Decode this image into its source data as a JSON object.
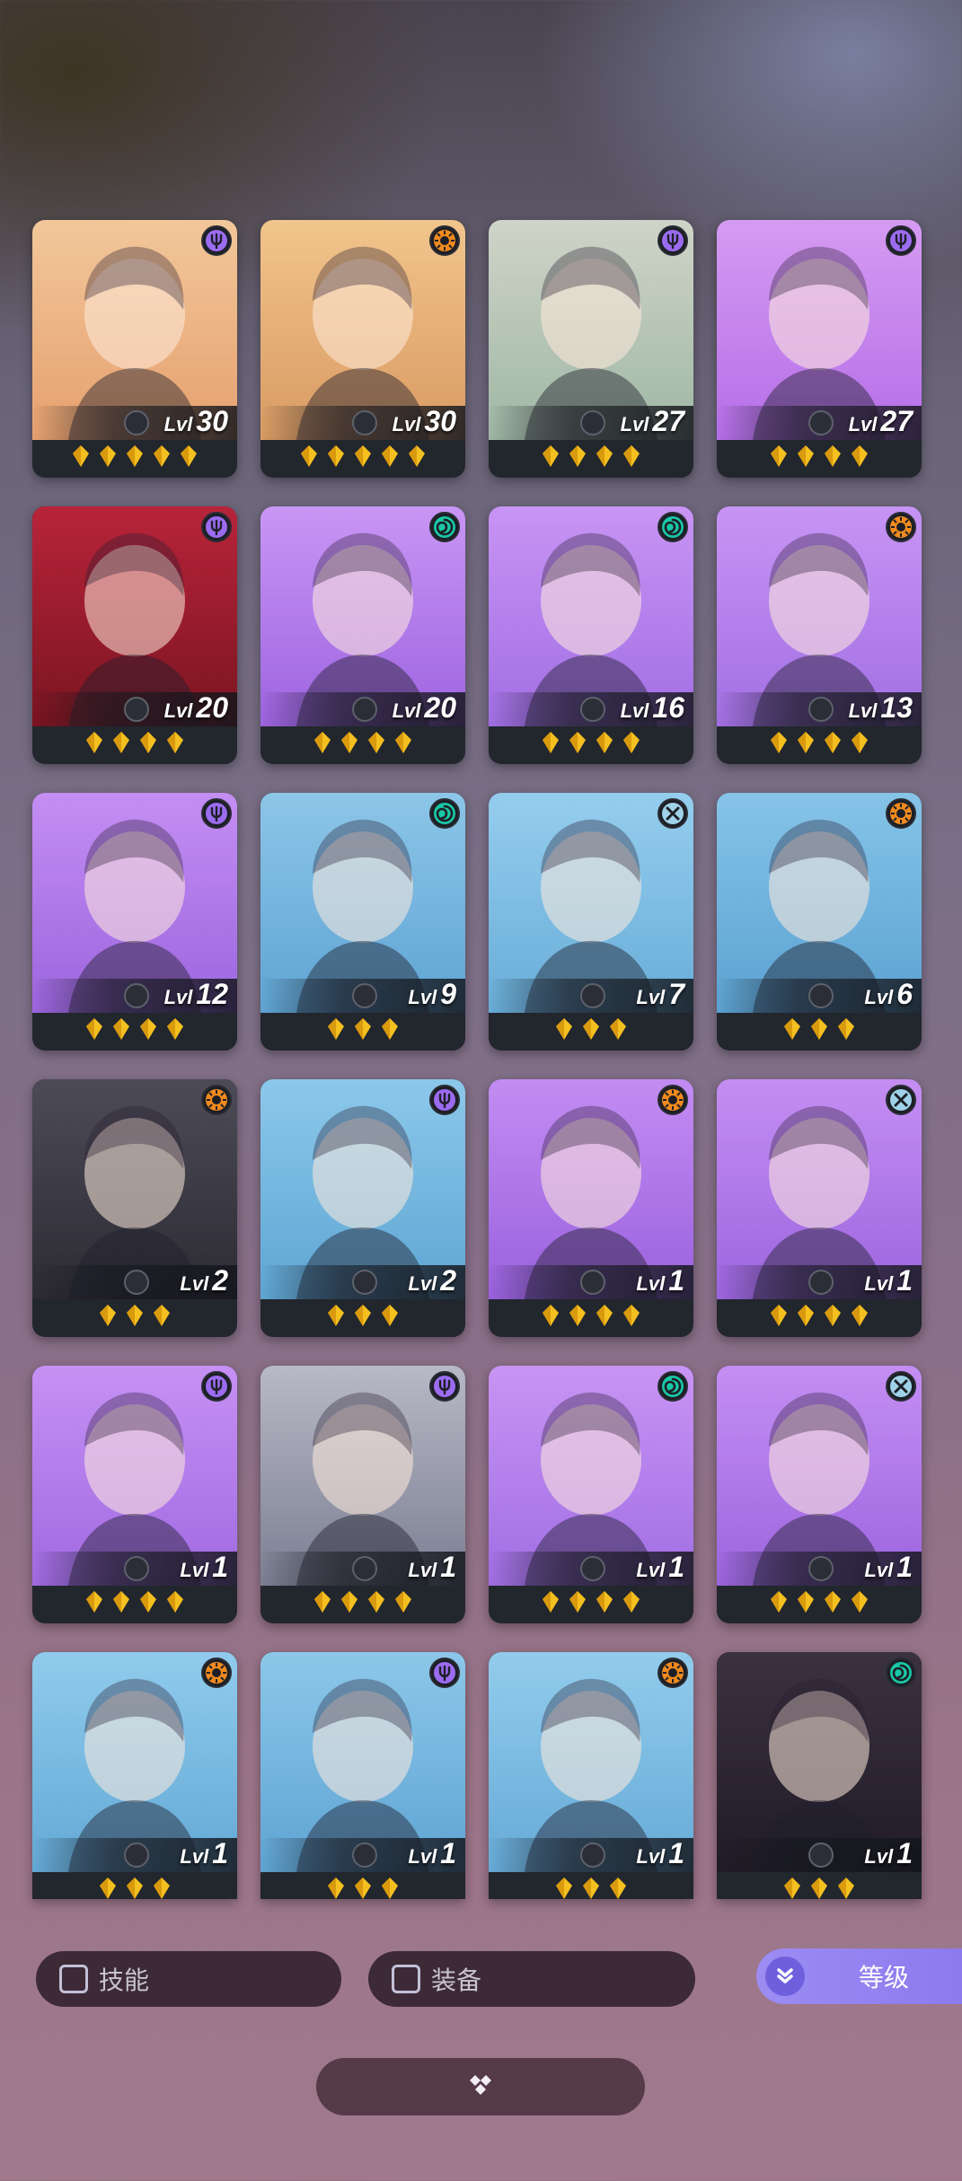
{
  "heroes": [
    {
      "level": "30",
      "stars": 5,
      "faction": "psi",
      "bg": [
        "#f2c79a",
        "#e6a06e"
      ]
    },
    {
      "level": "30",
      "stars": 5,
      "faction": "sun",
      "bg": [
        "#f1c58c",
        "#d99a63"
      ]
    },
    {
      "level": "27",
      "stars": 4,
      "faction": "psi",
      "bg": [
        "#cfd4c8",
        "#9fb7a4"
      ]
    },
    {
      "level": "27",
      "stars": 4,
      "faction": "psi",
      "bg": [
        "#d59bf2",
        "#b56ee8"
      ]
    },
    {
      "level": "20",
      "stars": 4,
      "faction": "psi",
      "bg": [
        "#b8243a",
        "#7a1420"
      ]
    },
    {
      "level": "20",
      "stars": 4,
      "faction": "swirl",
      "bg": [
        "#c996f5",
        "#9d63e0"
      ]
    },
    {
      "level": "16",
      "stars": 4,
      "faction": "swirl",
      "bg": [
        "#c894f4",
        "#a16ee4"
      ]
    },
    {
      "level": "13",
      "stars": 4,
      "faction": "sun",
      "bg": [
        "#c794f5",
        "#a26fe3"
      ]
    },
    {
      "level": "12",
      "stars": 4,
      "faction": "psi",
      "bg": [
        "#c48ef3",
        "#9c65df"
      ]
    },
    {
      "level": "9",
      "stars": 3,
      "faction": "swirl",
      "bg": [
        "#8cc6e8",
        "#5fa4d4"
      ]
    },
    {
      "level": "7",
      "stars": 3,
      "faction": "cross",
      "bg": [
        "#95cdee",
        "#68add8"
      ]
    },
    {
      "level": "6",
      "stars": 3,
      "faction": "sun",
      "bg": [
        "#86c4e8",
        "#5ba2d2"
      ]
    },
    {
      "level": "2",
      "stars": 3,
      "faction": "sun",
      "bg": [
        "#4d4b57",
        "#2c2b33"
      ]
    },
    {
      "level": "2",
      "stars": 3,
      "faction": "psi",
      "bg": [
        "#8cc8ea",
        "#5ea6d4"
      ]
    },
    {
      "level": "1",
      "stars": 4,
      "faction": "sun",
      "bg": [
        "#c38cf2",
        "#9961de"
      ]
    },
    {
      "level": "1",
      "stars": 4,
      "faction": "cross",
      "bg": [
        "#c48ef3",
        "#9c65df"
      ]
    },
    {
      "level": "1",
      "stars": 4,
      "faction": "psi",
      "bg": [
        "#c690f4",
        "#a06ae2"
      ]
    },
    {
      "level": "1",
      "stars": 4,
      "faction": "psi",
      "bg": [
        "#b8b9c6",
        "#7b7f92"
      ]
    },
    {
      "level": "1",
      "stars": 4,
      "faction": "swirl",
      "bg": [
        "#c894f4",
        "#a16ee4"
      ]
    },
    {
      "level": "1",
      "stars": 4,
      "faction": "cross",
      "bg": [
        "#c48ef3",
        "#9c65df"
      ]
    },
    {
      "level": "1",
      "stars": 3,
      "faction": "sun",
      "bg": [
        "#90cbec",
        "#63a9d6"
      ]
    },
    {
      "level": "1",
      "stars": 3,
      "faction": "psi",
      "bg": [
        "#8cc7e9",
        "#5fa4d4"
      ]
    },
    {
      "level": "1",
      "stars": 3,
      "faction": "sun",
      "bg": [
        "#92ccec",
        "#66aad7"
      ]
    },
    {
      "level": "1",
      "stars": 3,
      "faction": "swirl",
      "bg": [
        "#3b3240",
        "#201b26"
      ]
    }
  ],
  "level_prefix": "Lvl",
  "filters": {
    "skill_label": "技能",
    "equipment_label": "装备",
    "sort_label": "等级"
  },
  "colors": {
    "psi": "#9b6bf0",
    "sun": "#f08a1e",
    "swirl": "#19c7a6",
    "cross": "#9fd2e8",
    "star": "#f4c020",
    "accent": "#9c8cf2"
  }
}
